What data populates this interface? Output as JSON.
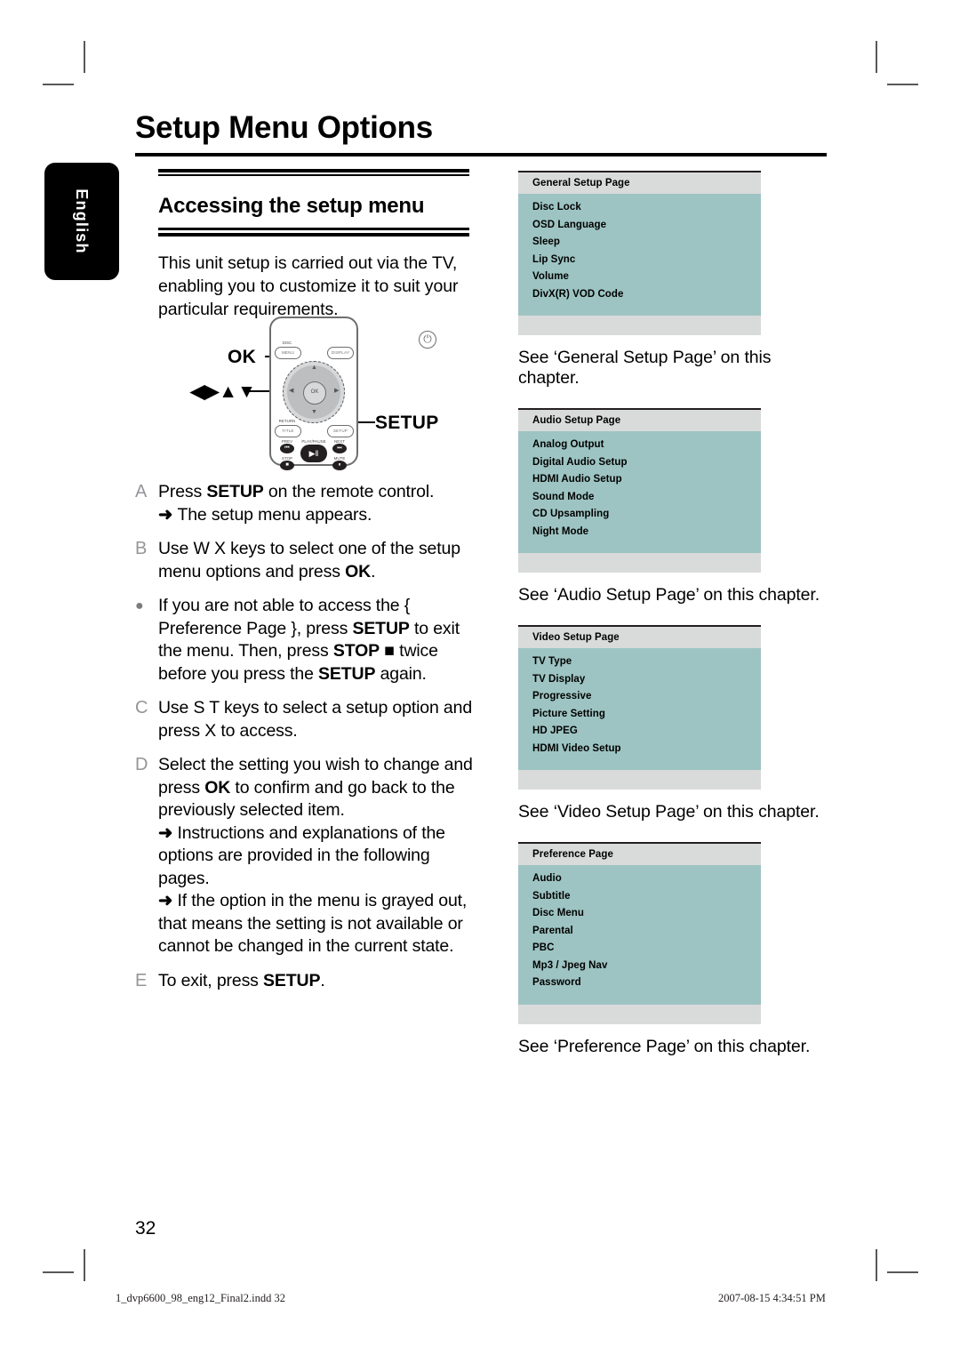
{
  "page_title": "Setup Menu Options",
  "language_tab": "English",
  "section": {
    "heading": "Accessing the setup menu",
    "intro": "This unit setup is carried out via the TV, enabling you to customize it to suit your particular requirements."
  },
  "remote_figure": {
    "label_ok": "OK",
    "label_arrows": "◀▶▲▼",
    "label_setup": "SETUP",
    "buttons": {
      "power": "⏻",
      "disc_menu_caption": "DISC",
      "disc_menu": "MENU",
      "display": "DISPLAY",
      "return_caption": "RETURN",
      "title": "TITLE",
      "setup": "SETUP",
      "ok": "OK",
      "nav_up": "▲",
      "nav_down": "▼",
      "nav_left": "◀",
      "nav_right": "▶",
      "prev_caption": "PREV",
      "prev": "⏮",
      "next_caption": "NEXT",
      "next": "⏭",
      "stop_caption": "STOP",
      "stop": "■",
      "mute_caption": "MUTE",
      "mute": "⏸",
      "playpause_caption": "PLAY/PAUSE",
      "playpause": "▶‖"
    }
  },
  "steps": [
    {
      "marker": "A",
      "type": "letter",
      "lines": [
        {
          "kind": "text",
          "segments": [
            {
              "t": "Press ",
              "b": false
            },
            {
              "t": "SETUP",
              "b": true
            },
            {
              "t": " on the remote control.",
              "b": false
            }
          ]
        },
        {
          "kind": "arrow",
          "segments": [
            {
              "t": "The setup menu appears.",
              "b": false
            }
          ]
        }
      ]
    },
    {
      "marker": "B",
      "type": "letter",
      "lines": [
        {
          "kind": "text",
          "segments": [
            {
              "t": "Use  W X keys to select one of the setup menu options and press ",
              "b": false
            },
            {
              "t": "OK",
              "b": true
            },
            {
              "t": ".",
              "b": false
            }
          ]
        }
      ]
    },
    {
      "marker": "●",
      "type": "bullet",
      "lines": [
        {
          "kind": "text",
          "segments": [
            {
              "t": "If you are not able to access the { Preference Page }, press ",
              "b": false
            },
            {
              "t": "SETUP",
              "b": true
            },
            {
              "t": " to exit the menu. Then, press ",
              "b": false
            },
            {
              "t": "STOP",
              "b": true
            },
            {
              "t": " ■ twice before you press the ",
              "b": false
            },
            {
              "t": "SETUP",
              "b": true
            },
            {
              "t": " again.",
              "b": false
            }
          ]
        }
      ]
    },
    {
      "marker": "C",
      "type": "letter",
      "lines": [
        {
          "kind": "text",
          "segments": [
            {
              "t": "Use  S T keys to select a setup option and press  X to access.",
              "b": false
            }
          ]
        }
      ]
    },
    {
      "marker": "D",
      "type": "letter",
      "lines": [
        {
          "kind": "text",
          "segments": [
            {
              "t": "Select the setting you wish to change and press ",
              "b": false
            },
            {
              "t": "OK",
              "b": true
            },
            {
              "t": " to confirm and go back to the previously selected item.",
              "b": false
            }
          ]
        },
        {
          "kind": "arrow",
          "segments": [
            {
              "t": "Instructions and explanations of the options are provided in the following pages.",
              "b": false
            }
          ]
        },
        {
          "kind": "arrow",
          "segments": [
            {
              "t": "If the option in the menu is grayed out, that means the setting is not available or cannot be changed in the current state.",
              "b": false
            }
          ]
        }
      ]
    },
    {
      "marker": "E",
      "type": "letter",
      "lines": [
        {
          "kind": "text",
          "segments": [
            {
              "t": "To exit, press ",
              "b": false
            },
            {
              "t": "SETUP",
              "b": true
            },
            {
              "t": ".",
              "b": false
            }
          ]
        }
      ]
    }
  ],
  "setup_boxes": [
    {
      "title": "General Setup Page",
      "options": [
        "Disc Lock",
        "OSD Language",
        "Sleep",
        "Lip Sync",
        "Volume",
        "DivX(R) VOD Code"
      ],
      "caption": "See ‘General Setup Page’ on this chapter."
    },
    {
      "title": "Audio Setup Page",
      "options": [
        "Analog Output",
        "Digital Audio Setup",
        "HDMI Audio Setup",
        "Sound Mode",
        "CD Upsampling",
        "Night Mode"
      ],
      "caption": "See ‘Audio Setup Page’ on this chapter."
    },
    {
      "title": "Video Setup Page",
      "options": [
        "TV Type",
        "TV Display",
        "Progressive",
        "Picture Setting",
        "HD JPEG",
        "HDMI Video Setup"
      ],
      "caption": "See ‘Video Setup Page’ on this chapter."
    },
    {
      "title": "Preference Page",
      "options": [
        "Audio",
        "Subtitle",
        "Disc Menu",
        "Parental",
        "PBC",
        "Mp3 / Jpeg Nav",
        "Password"
      ],
      "caption": "See ‘Preference Page’ on this chapter."
    }
  ],
  "page_number": "32",
  "footer": {
    "left": "1_dvp6600_98_eng12_Final2.indd   32",
    "right": "2007-08-15   4:34:51 PM"
  },
  "colors": {
    "box_header": "#d9dada",
    "box_body": "#9dc4c2",
    "box_rule": "#231f20",
    "marker_gray": "#939598",
    "tab_black": "#000000",
    "cropmark": "#58585a"
  }
}
